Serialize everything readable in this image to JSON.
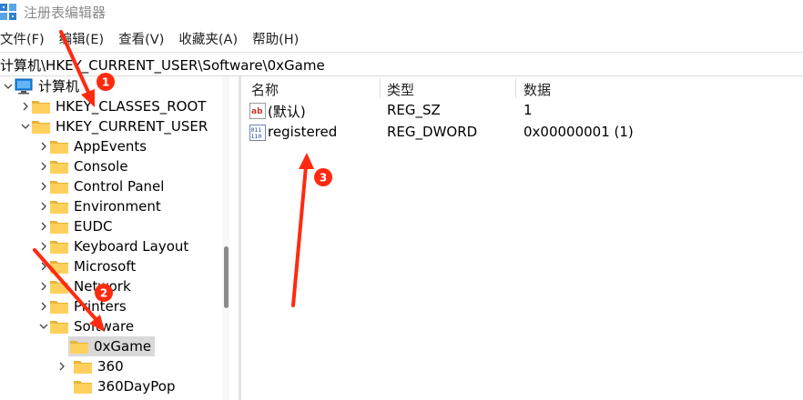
{
  "window": {
    "title": "注册表编辑器"
  },
  "menu": [
    "文件(F)",
    "编辑(E)",
    "查看(V)",
    "收藏夹(A)",
    "帮助(H)"
  ],
  "address": "计算机\\HKEY_CURRENT_USER\\Software\\0xGame",
  "tree": {
    "root": "计算机",
    "hkcr": "HKEY_CLASSES_ROOT",
    "hkcu": "HKEY_CURRENT_USER",
    "children": [
      "AppEvents",
      "Console",
      "Control Panel",
      "Environment",
      "EUDC",
      "Keyboard Layout",
      "Microsoft",
      "Network",
      "Printers",
      "Software"
    ],
    "software_children": [
      "0xGame",
      "360",
      "360DayPop"
    ]
  },
  "list": {
    "headers": {
      "name": "名称",
      "type": "类型",
      "data": "数据"
    },
    "rows": [
      {
        "name": "(默认)",
        "type": "REG_SZ",
        "data": "1",
        "icon": "string-value-icon"
      },
      {
        "name": "registered",
        "type": "REG_DWORD",
        "data": "0x00000001 (1)",
        "icon": "dword-value-icon"
      }
    ]
  },
  "annotations": {
    "badge_1": "1",
    "badge_2": "2",
    "badge_3": "3",
    "color": "#ff2a0f"
  }
}
